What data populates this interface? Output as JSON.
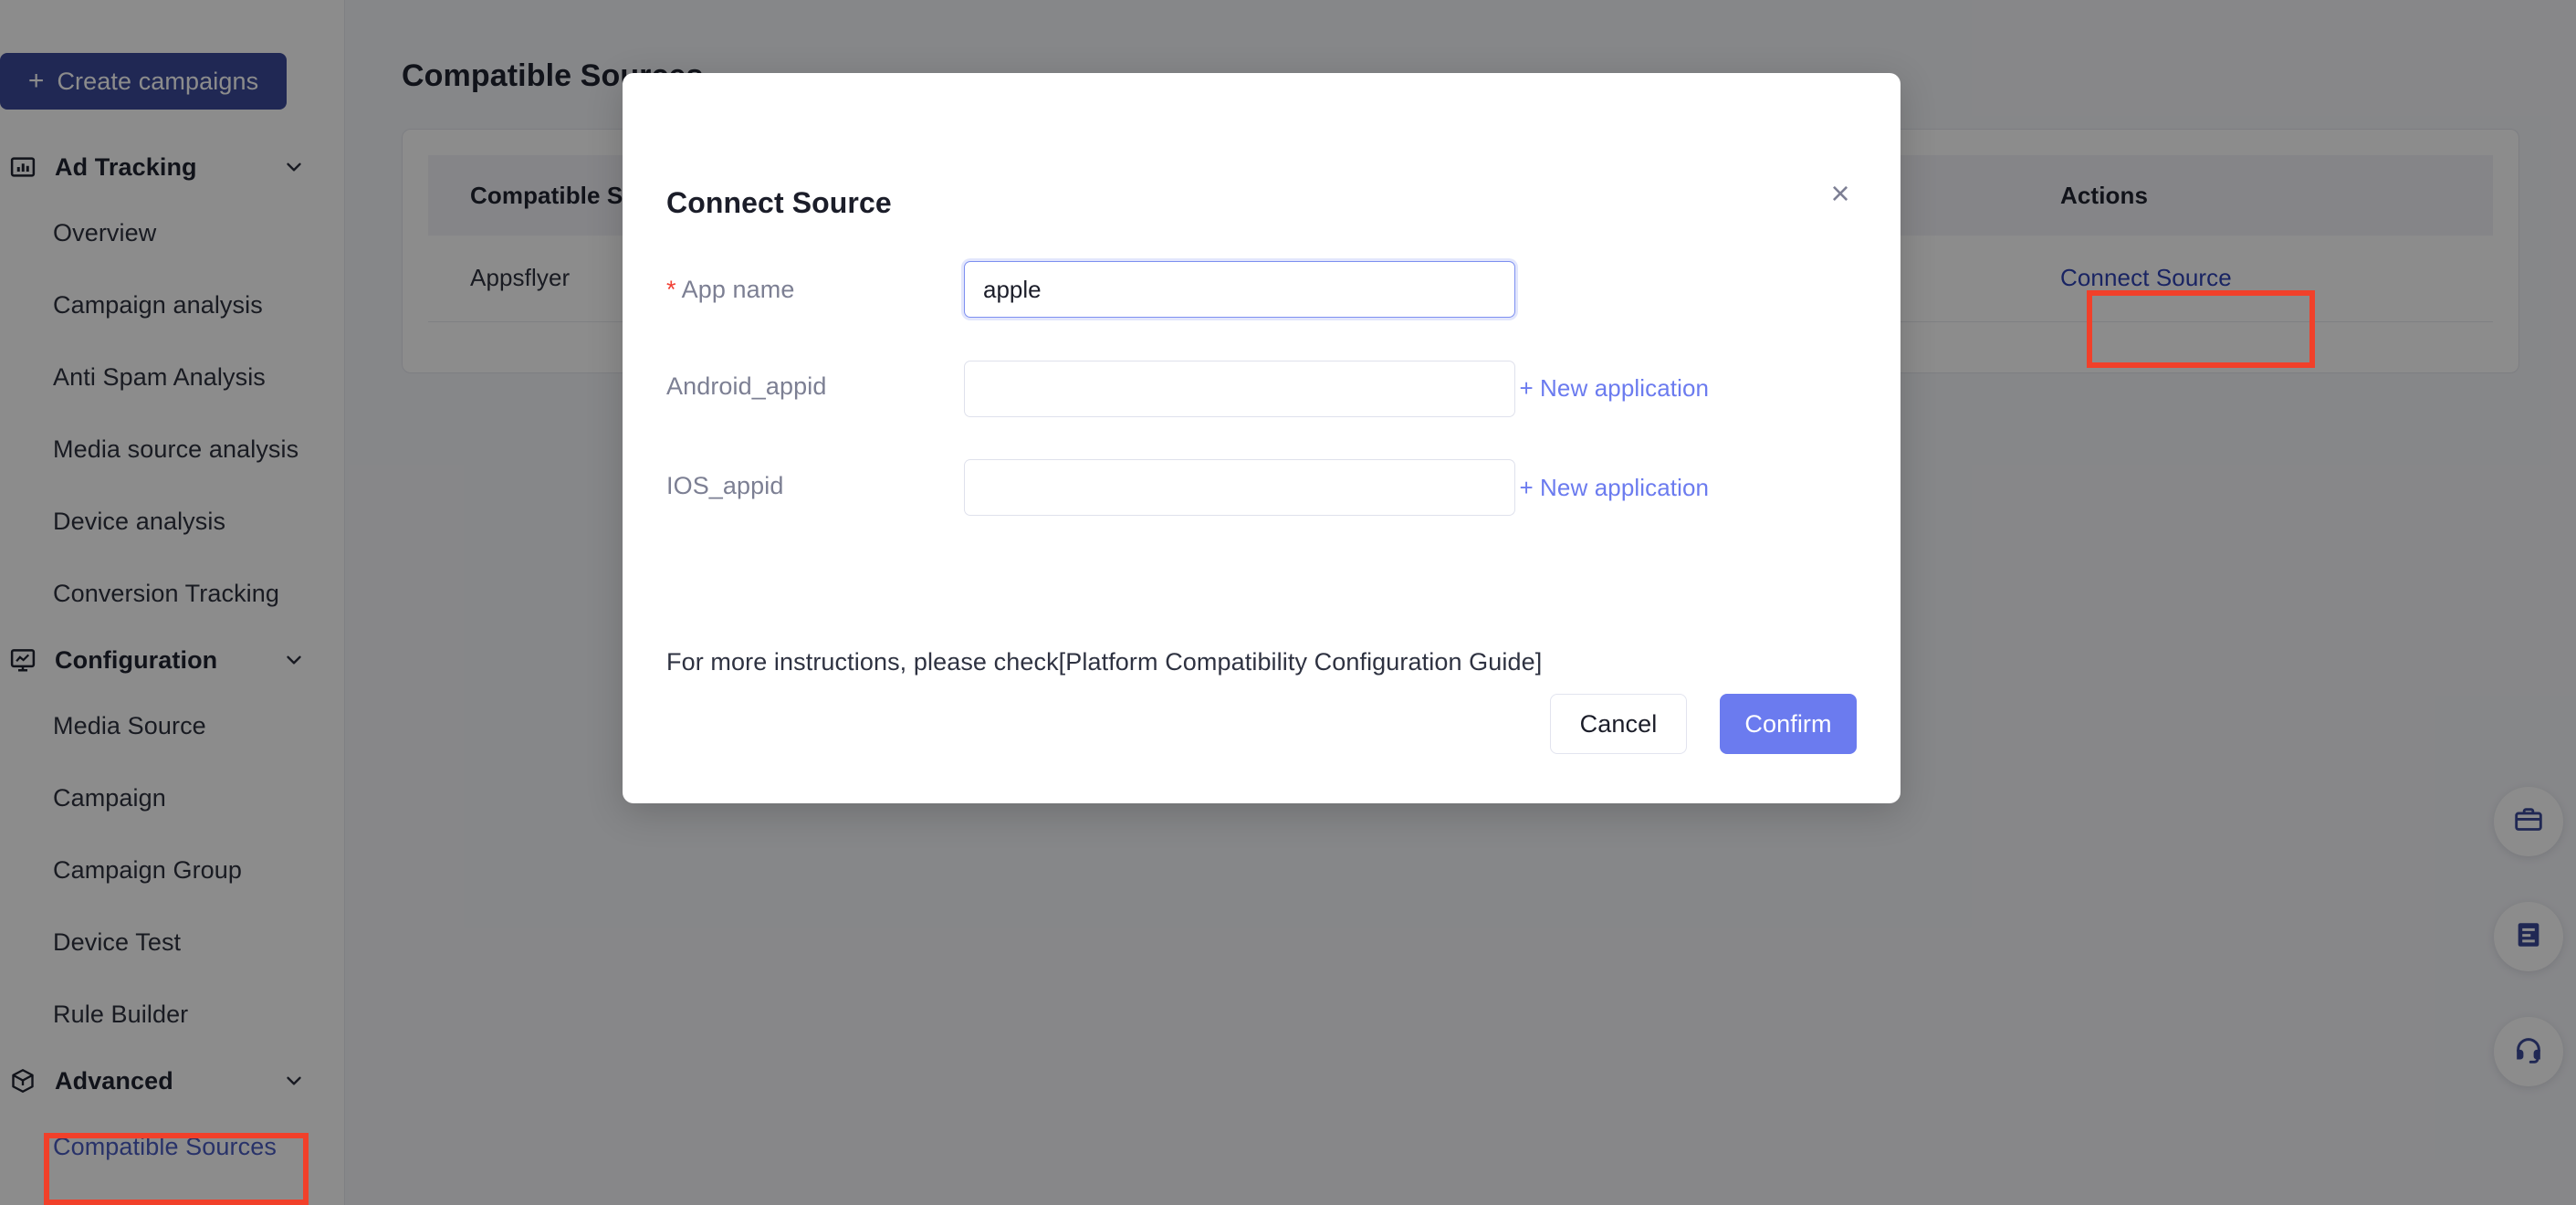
{
  "sidebar": {
    "create_button": {
      "label": "Create campaigns",
      "icon": "plus-icon"
    },
    "groups": [
      {
        "label": "Ad Tracking",
        "icon": "bar-chart-frame-icon",
        "expanded": true,
        "items": [
          {
            "label": "Overview",
            "active": false
          },
          {
            "label": "Campaign analysis",
            "active": false
          },
          {
            "label": "Anti Spam Analysis",
            "active": false
          },
          {
            "label": "Media source analysis",
            "active": false
          },
          {
            "label": "Device analysis",
            "active": false
          },
          {
            "label": "Conversion Tracking",
            "active": false
          }
        ]
      },
      {
        "label": "Configuration",
        "icon": "monitor-chart-icon",
        "expanded": true,
        "items": [
          {
            "label": "Media Source",
            "active": false
          },
          {
            "label": "Campaign",
            "active": false
          },
          {
            "label": "Campaign Group",
            "active": false
          },
          {
            "label": "Device Test",
            "active": false
          },
          {
            "label": "Rule Builder",
            "active": false
          }
        ]
      },
      {
        "label": "Advanced",
        "icon": "cube-icon",
        "expanded": true,
        "items": [
          {
            "label": "Compatible Sources",
            "active": true
          }
        ]
      }
    ]
  },
  "main": {
    "page_title": "Compatible Sources",
    "table": {
      "columns": [
        "Compatible Sources",
        "Actions"
      ],
      "rows": [
        {
          "source": "Appsflyer",
          "action": "Connect Source"
        }
      ]
    }
  },
  "right_rail": {
    "buttons": [
      {
        "icon": "briefcase-icon"
      },
      {
        "icon": "document-icon"
      },
      {
        "icon": "headset-support-icon"
      }
    ]
  },
  "modal": {
    "title": "Connect Source",
    "close_label": "×",
    "fields": [
      {
        "label": "App name",
        "required": true,
        "value": "apple",
        "placeholder": "",
        "focused": true,
        "new_app_link": null
      },
      {
        "label": "Android_appid",
        "required": false,
        "value": "",
        "placeholder": "",
        "focused": false,
        "new_app_link": "+ New application"
      },
      {
        "label": "IOS_appid",
        "required": false,
        "value": "",
        "placeholder": "",
        "focused": false,
        "new_app_link": "+ New application"
      }
    ],
    "hint": "For more instructions, please check[Platform Compatibility Configuration Guide]",
    "cancel_label": "Cancel",
    "confirm_label": "Confirm"
  },
  "colors": {
    "brand_dark": "#3b4a99",
    "accent": "#6b7bef",
    "link": "#2f42b5",
    "required_star": "#f14135",
    "annotation": "#f1402a"
  }
}
